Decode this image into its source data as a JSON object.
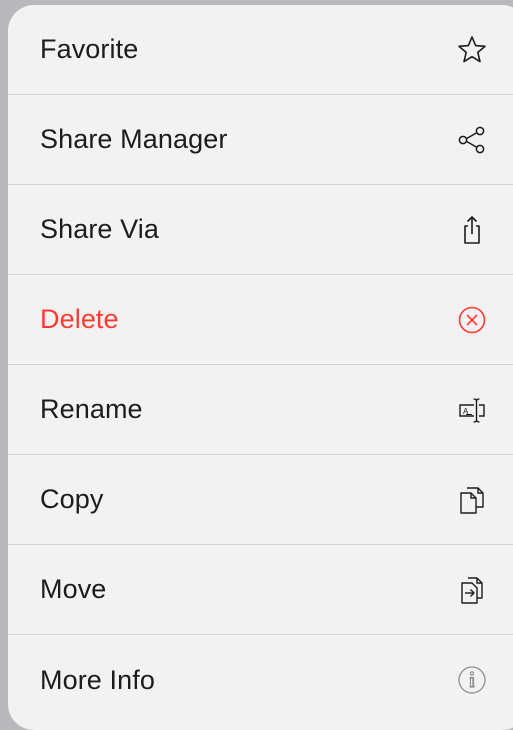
{
  "menu": {
    "items": [
      {
        "label": "Favorite",
        "icon": "star-icon"
      },
      {
        "label": "Share Manager",
        "icon": "share-nodes-icon"
      },
      {
        "label": "Share Via",
        "icon": "share-up-icon"
      },
      {
        "label": "Delete",
        "icon": "delete-circle-x-icon",
        "color": "#ff3b30"
      },
      {
        "label": "Rename",
        "icon": "rename-text-cursor-icon"
      },
      {
        "label": "Copy",
        "icon": "copy-documents-icon"
      },
      {
        "label": "Move",
        "icon": "move-document-icon"
      },
      {
        "label": "More Info",
        "icon": "info-circle-icon"
      }
    ]
  },
  "colors": {
    "text": "#1c1c1e",
    "destructive": "#ff3b30",
    "menu_background": "#f2f2f3",
    "separator": "#d5d5d8",
    "backdrop": "#b9b9bd"
  }
}
